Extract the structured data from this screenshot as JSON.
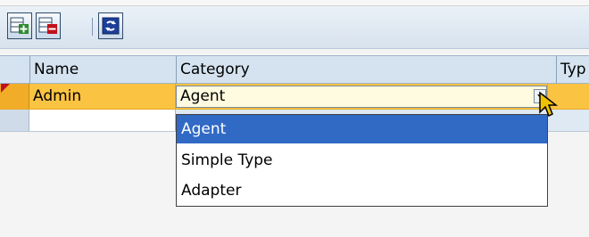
{
  "toolbar": {
    "buttons": [
      {
        "icon": "add-row-icon",
        "color": "#2c8a2c"
      },
      {
        "icon": "remove-row-icon",
        "color": "#c0101a"
      },
      {
        "icon": "refresh-icon",
        "color": "#1c3f9a"
      }
    ]
  },
  "table": {
    "columns": [
      "Name",
      "Category",
      "Typ"
    ],
    "rows": [
      {
        "name": "Admin",
        "category": "Agent",
        "selected": true
      }
    ]
  },
  "dropdown": {
    "options": [
      "Agent",
      "Simple Type",
      "Adapter"
    ],
    "selected_index": 0
  },
  "colors": {
    "selected_row": "#fbc342",
    "dropdown_highlight": "#316ac5",
    "header": "#d5e3f0"
  }
}
